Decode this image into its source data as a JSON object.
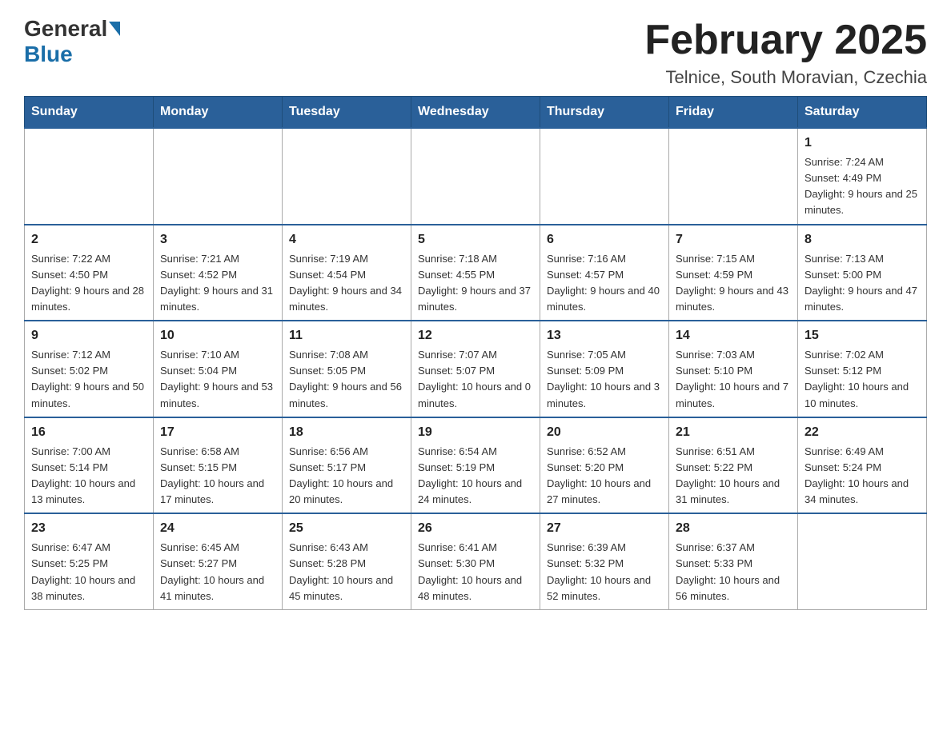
{
  "header": {
    "title": "February 2025",
    "subtitle": "Telnice, South Moravian, Czechia",
    "logo_general": "General",
    "logo_blue": "Blue"
  },
  "weekdays": [
    "Sunday",
    "Monday",
    "Tuesday",
    "Wednesday",
    "Thursday",
    "Friday",
    "Saturday"
  ],
  "weeks": [
    [
      {
        "day": "",
        "info": ""
      },
      {
        "day": "",
        "info": ""
      },
      {
        "day": "",
        "info": ""
      },
      {
        "day": "",
        "info": ""
      },
      {
        "day": "",
        "info": ""
      },
      {
        "day": "",
        "info": ""
      },
      {
        "day": "1",
        "info": "Sunrise: 7:24 AM\nSunset: 4:49 PM\nDaylight: 9 hours and 25 minutes."
      }
    ],
    [
      {
        "day": "2",
        "info": "Sunrise: 7:22 AM\nSunset: 4:50 PM\nDaylight: 9 hours and 28 minutes."
      },
      {
        "day": "3",
        "info": "Sunrise: 7:21 AM\nSunset: 4:52 PM\nDaylight: 9 hours and 31 minutes."
      },
      {
        "day": "4",
        "info": "Sunrise: 7:19 AM\nSunset: 4:54 PM\nDaylight: 9 hours and 34 minutes."
      },
      {
        "day": "5",
        "info": "Sunrise: 7:18 AM\nSunset: 4:55 PM\nDaylight: 9 hours and 37 minutes."
      },
      {
        "day": "6",
        "info": "Sunrise: 7:16 AM\nSunset: 4:57 PM\nDaylight: 9 hours and 40 minutes."
      },
      {
        "day": "7",
        "info": "Sunrise: 7:15 AM\nSunset: 4:59 PM\nDaylight: 9 hours and 43 minutes."
      },
      {
        "day": "8",
        "info": "Sunrise: 7:13 AM\nSunset: 5:00 PM\nDaylight: 9 hours and 47 minutes."
      }
    ],
    [
      {
        "day": "9",
        "info": "Sunrise: 7:12 AM\nSunset: 5:02 PM\nDaylight: 9 hours and 50 minutes."
      },
      {
        "day": "10",
        "info": "Sunrise: 7:10 AM\nSunset: 5:04 PM\nDaylight: 9 hours and 53 minutes."
      },
      {
        "day": "11",
        "info": "Sunrise: 7:08 AM\nSunset: 5:05 PM\nDaylight: 9 hours and 56 minutes."
      },
      {
        "day": "12",
        "info": "Sunrise: 7:07 AM\nSunset: 5:07 PM\nDaylight: 10 hours and 0 minutes."
      },
      {
        "day": "13",
        "info": "Sunrise: 7:05 AM\nSunset: 5:09 PM\nDaylight: 10 hours and 3 minutes."
      },
      {
        "day": "14",
        "info": "Sunrise: 7:03 AM\nSunset: 5:10 PM\nDaylight: 10 hours and 7 minutes."
      },
      {
        "day": "15",
        "info": "Sunrise: 7:02 AM\nSunset: 5:12 PM\nDaylight: 10 hours and 10 minutes."
      }
    ],
    [
      {
        "day": "16",
        "info": "Sunrise: 7:00 AM\nSunset: 5:14 PM\nDaylight: 10 hours and 13 minutes."
      },
      {
        "day": "17",
        "info": "Sunrise: 6:58 AM\nSunset: 5:15 PM\nDaylight: 10 hours and 17 minutes."
      },
      {
        "day": "18",
        "info": "Sunrise: 6:56 AM\nSunset: 5:17 PM\nDaylight: 10 hours and 20 minutes."
      },
      {
        "day": "19",
        "info": "Sunrise: 6:54 AM\nSunset: 5:19 PM\nDaylight: 10 hours and 24 minutes."
      },
      {
        "day": "20",
        "info": "Sunrise: 6:52 AM\nSunset: 5:20 PM\nDaylight: 10 hours and 27 minutes."
      },
      {
        "day": "21",
        "info": "Sunrise: 6:51 AM\nSunset: 5:22 PM\nDaylight: 10 hours and 31 minutes."
      },
      {
        "day": "22",
        "info": "Sunrise: 6:49 AM\nSunset: 5:24 PM\nDaylight: 10 hours and 34 minutes."
      }
    ],
    [
      {
        "day": "23",
        "info": "Sunrise: 6:47 AM\nSunset: 5:25 PM\nDaylight: 10 hours and 38 minutes."
      },
      {
        "day": "24",
        "info": "Sunrise: 6:45 AM\nSunset: 5:27 PM\nDaylight: 10 hours and 41 minutes."
      },
      {
        "day": "25",
        "info": "Sunrise: 6:43 AM\nSunset: 5:28 PM\nDaylight: 10 hours and 45 minutes."
      },
      {
        "day": "26",
        "info": "Sunrise: 6:41 AM\nSunset: 5:30 PM\nDaylight: 10 hours and 48 minutes."
      },
      {
        "day": "27",
        "info": "Sunrise: 6:39 AM\nSunset: 5:32 PM\nDaylight: 10 hours and 52 minutes."
      },
      {
        "day": "28",
        "info": "Sunrise: 6:37 AM\nSunset: 5:33 PM\nDaylight: 10 hours and 56 minutes."
      },
      {
        "day": "",
        "info": ""
      }
    ]
  ]
}
